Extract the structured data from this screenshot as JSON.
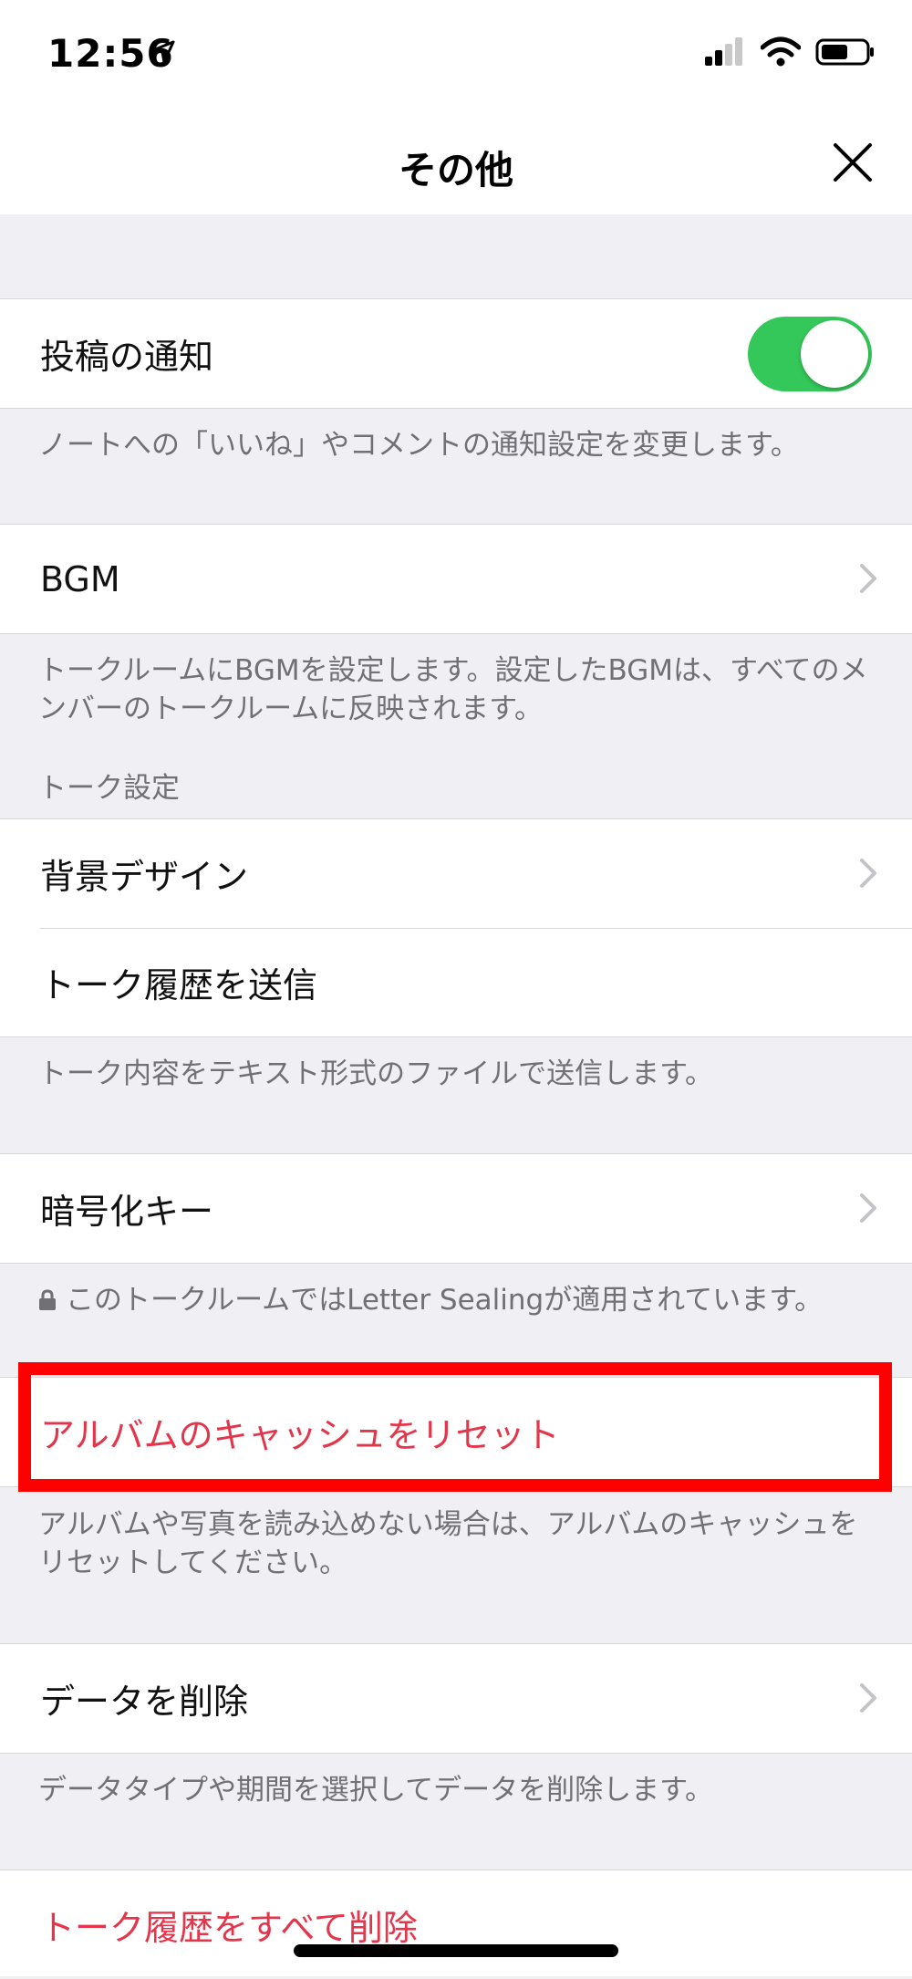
{
  "status_bar": {
    "time": "12:56"
  },
  "nav": {
    "title": "その他",
    "close_icon": "close-icon"
  },
  "rows": {
    "post_notification": {
      "label": "投稿の通知",
      "toggle_on": true,
      "description": "ノートへの「いいね」やコメントの通知設定を変更します。"
    },
    "bgm": {
      "label": "BGM",
      "description": "トークルームにBGMを設定します。設定したBGMは、すべてのメンバーのトークルームに反映されます。"
    },
    "talk_settings_header": "トーク設定",
    "background_design": {
      "label": "背景デザイン"
    },
    "send_history": {
      "label": "トーク履歴を送信",
      "description": "トーク内容をテキスト形式のファイルで送信します。"
    },
    "encryption_key": {
      "label": "暗号化キー",
      "description": "このトークルームではLetter Sealingが適用されています。"
    },
    "reset_album_cache": {
      "label": "アルバムのキャッシュをリセット",
      "description": "アルバムや写真を読み込めない場合は、アルバムのキャッシュをリセットしてください。"
    },
    "delete_data": {
      "label": "データを削除",
      "description": "データタイプや期間を選択してデータを削除します。"
    },
    "delete_all_history": {
      "label": "トーク履歴をすべて削除"
    }
  },
  "colors": {
    "danger": "#e5354b",
    "toggle_on": "#34c759",
    "highlight": "#ff0000"
  }
}
